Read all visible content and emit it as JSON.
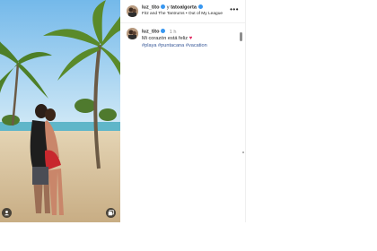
{
  "post": {
    "author": "luz_tito",
    "connector": "y",
    "coauthor": "tatoalgorta",
    "audio": "Fitz and The Tantrums • Out of My League",
    "more_label": "•••"
  },
  "caption": {
    "author": "luz_tito",
    "time": "1 h",
    "text": "Mi corazón está feliz",
    "emoji": "♥",
    "hashtags": "#playa #puntacana #vacation"
  },
  "colors": {
    "verified": "#3897f0",
    "hashtag": "#385898",
    "heart": "#e0245e"
  },
  "icons": [
    "user-tag-icon",
    "carousel-icon",
    "more-options-icon",
    "verified-badge-icon"
  ]
}
